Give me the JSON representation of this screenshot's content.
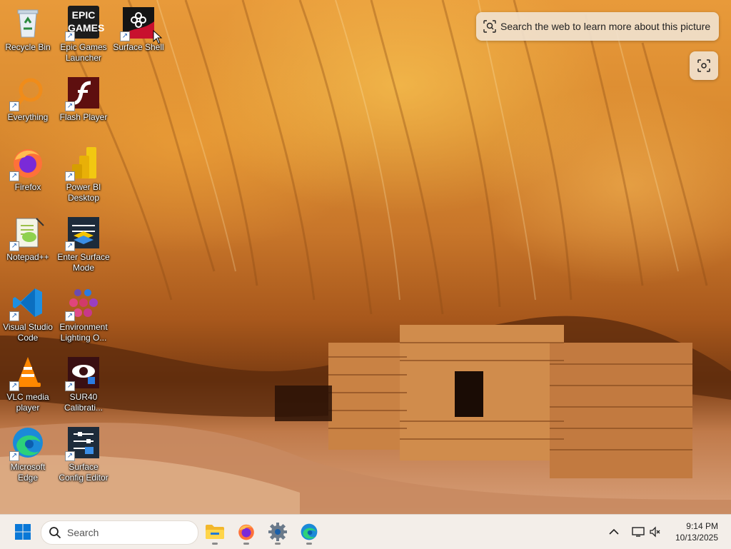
{
  "desktop": {
    "icons": [
      {
        "label": "Recycle Bin",
        "icon": "recycle-bin-icon"
      },
      {
        "label": "Epic Games Launcher",
        "icon": "epic-games-icon",
        "art_text": "EPIC GAMES"
      },
      {
        "label": "Surface Shell",
        "icon": "surface-shell-icon"
      },
      {
        "label": "Everything",
        "icon": "everything-search-icon"
      },
      {
        "label": "Flash Player",
        "icon": "flash-player-icon"
      },
      {
        "label": "Firefox",
        "icon": "firefox-icon"
      },
      {
        "label": "Power BI Desktop",
        "icon": "power-bi-icon"
      },
      {
        "label": "Notepad++",
        "icon": "notepad-plus-plus-icon"
      },
      {
        "label": "Enter Surface Mode",
        "icon": "surface-mode-icon"
      },
      {
        "label": "Visual Studio Code",
        "icon": "vscode-icon"
      },
      {
        "label": "Environment Lighting O...",
        "icon": "environment-lighting-icon"
      },
      {
        "label": "VLC media player",
        "icon": "vlc-icon"
      },
      {
        "label": "SUR40 Calibrati...",
        "icon": "sur40-calibration-icon"
      },
      {
        "label": "Microsoft Edge",
        "icon": "edge-icon"
      },
      {
        "label": "Surface Config Editor",
        "icon": "surface-config-editor-icon"
      }
    ]
  },
  "web_search": {
    "label": "Search the web to learn more about this picture"
  },
  "taskbar": {
    "search_placeholder": "Search",
    "pinned": [
      {
        "name": "file-explorer",
        "icon": "folder-icon"
      },
      {
        "name": "firefox",
        "icon": "firefox-icon"
      },
      {
        "name": "settings",
        "icon": "gear-icon"
      },
      {
        "name": "edge",
        "icon": "edge-icon"
      }
    ],
    "time": "9:14 PM",
    "date": "10/13/2025"
  },
  "colors": {
    "taskbar_bg": "#f3eee9",
    "windows_blue": "#0a78d7",
    "label_text": "#ffffff"
  }
}
